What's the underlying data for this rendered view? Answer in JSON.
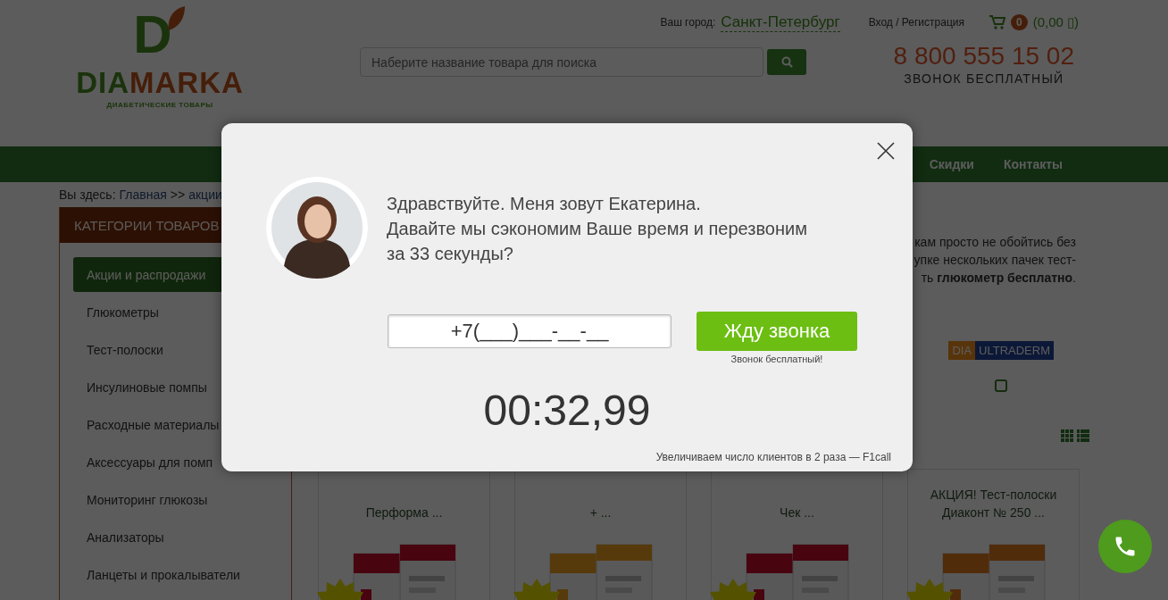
{
  "header": {
    "logo": {
      "mark": "D",
      "word_start": "DIA",
      "word_end": "MARKA",
      "tagline": "ДИАБЕТИЧЕСКИЕ ТОВАРЫ"
    },
    "city_label": "Ваш город:",
    "city": "Санкт-Петербург",
    "login": "Вход / Регистрация",
    "cart": {
      "count": "0",
      "total": "(0,00 ▯)"
    },
    "search": {
      "placeholder": "Наберите название товара для поиска"
    },
    "phone": "8 800 555 15 02",
    "phone_note": "ЗВОНОК БЕСПЛАТНЫЙ"
  },
  "nav": [
    {
      "label": "Скидки"
    },
    {
      "label": "Контакты"
    }
  ],
  "breadcrumb": [
    {
      "kind": "text",
      "text": "Вы здесь:"
    },
    {
      "kind": "link",
      "text": "Главная"
    },
    {
      "kind": "text",
      "text": ">>"
    },
    {
      "kind": "link",
      "text": "акции"
    }
  ],
  "sidebar": {
    "title": "КАТЕГОРИИ ТОВАРОВ",
    "items": [
      {
        "label": "Акции и распродажи",
        "selected": true
      },
      {
        "label": "Глюкометры",
        "selected": false
      },
      {
        "label": "Тест-полоски",
        "selected": false
      },
      {
        "label": "Инсулиновые помпы",
        "selected": false
      },
      {
        "label": "Расходные материалы",
        "selected": false
      },
      {
        "label": "Аксессуары для помп",
        "selected": false
      },
      {
        "label": "Мониторинг глюкозы",
        "selected": false
      },
      {
        "label": "Анализаторы",
        "selected": false
      },
      {
        "label": "Ланцеты и прокалыватели",
        "selected": false
      }
    ]
  },
  "intro_lines": [
    "кам просто не обойтись без",
    "упке нескольких пачек тест-",
    "ть **глюкометр бесплатно**."
  ],
  "brands": [
    {
      "start": "DIA",
      "end": "ULTRADERM",
      "checked": false
    }
  ],
  "cards": [
    {
      "title": "Перформа ..."
    },
    {
      "title": "+ ..."
    },
    {
      "title": "Чек ..."
    },
    {
      "title": "АКЦИЯ! Тест-полоски Диаконт № 250 ..."
    }
  ],
  "modal": {
    "greeting": [
      "Здравствуйте. Меня зовут Екатерина.",
      "Давайте мы сэкономим Ваше время и перезвоним",
      "за 33 секунды?"
    ],
    "phone_value": "+7(___)___-__-__",
    "button": "Жду звонка",
    "button_note": "Звонок бесплатный!",
    "timer": "00:32,99",
    "credit": "Увеличиваем число клиентов в 2 раза — F1call"
  }
}
